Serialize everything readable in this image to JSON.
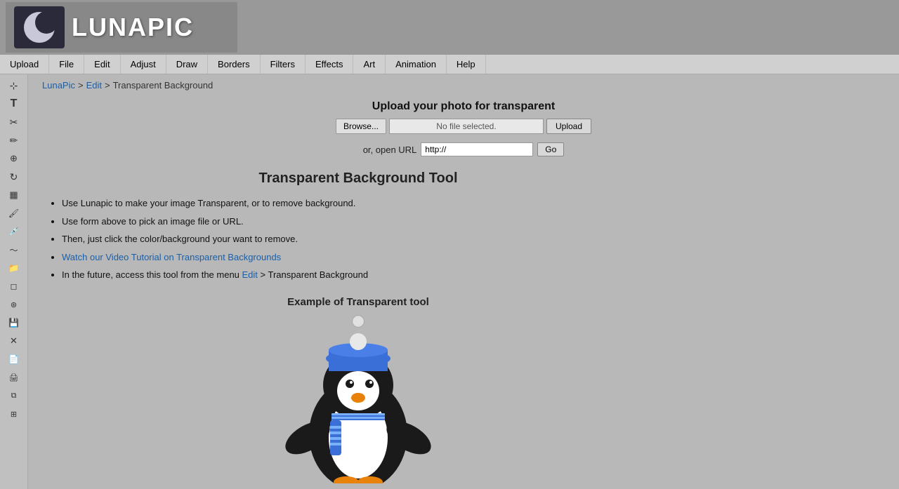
{
  "header": {
    "logo_text": "LUNAPIC"
  },
  "navbar": {
    "items": [
      {
        "id": "upload",
        "label": "Upload"
      },
      {
        "id": "file",
        "label": "File"
      },
      {
        "id": "edit",
        "label": "Edit"
      },
      {
        "id": "adjust",
        "label": "Adjust"
      },
      {
        "id": "draw",
        "label": "Draw"
      },
      {
        "id": "borders",
        "label": "Borders"
      },
      {
        "id": "filters",
        "label": "Filters"
      },
      {
        "id": "effects",
        "label": "Effects"
      },
      {
        "id": "art",
        "label": "Art"
      },
      {
        "id": "animation",
        "label": "Animation"
      },
      {
        "id": "help",
        "label": "Help"
      }
    ]
  },
  "breadcrumb": {
    "lunapic": "LunaPic",
    "edit": "Edit",
    "separator1": ">",
    "separator2": ">",
    "current": "Transparent Background"
  },
  "upload": {
    "title": "Upload your photo for transparent",
    "browse_label": "Browse...",
    "file_placeholder": "No file selected.",
    "upload_label": "Upload",
    "url_prefix": "or, open URL",
    "url_placeholder": "http://",
    "go_label": "Go"
  },
  "tool": {
    "title": "Transparent Background Tool",
    "bullets": [
      "Use Lunapic to make your image Transparent, or to remove background.",
      "Use form above to pick an image file or URL.",
      "Then, just click the color/background your want to remove.",
      "Watch our Video Tutorial on Transparent Backgrounds",
      "In the future, access this tool from the menu Edit > Transparent Background"
    ],
    "link_text": "Watch our Video Tutorial on Transparent Backgrounds",
    "menu_link_text": "Edit"
  },
  "example": {
    "title": "Example of Transparent tool"
  },
  "sidebar": {
    "icons": [
      {
        "id": "move",
        "symbol": "⊹",
        "name": "move-tool"
      },
      {
        "id": "text",
        "symbol": "T",
        "name": "text-tool"
      },
      {
        "id": "scissors",
        "symbol": "✂",
        "name": "cut-tool"
      },
      {
        "id": "pencil",
        "symbol": "✏",
        "name": "pencil-tool"
      },
      {
        "id": "zoom",
        "symbol": "🔍",
        "name": "zoom-tool"
      },
      {
        "id": "rotate",
        "symbol": "↻",
        "name": "rotate-tool"
      },
      {
        "id": "calendar",
        "symbol": "▦",
        "name": "calendar-tool"
      },
      {
        "id": "brush",
        "symbol": "🖌",
        "name": "brush-tool"
      },
      {
        "id": "eyedropper",
        "symbol": "⊘",
        "name": "eyedropper-tool"
      },
      {
        "id": "smudge",
        "symbol": "~",
        "name": "smudge-tool"
      },
      {
        "id": "folder",
        "symbol": "📁",
        "name": "folder-tool"
      },
      {
        "id": "eraser",
        "symbol": "◻",
        "name": "eraser-tool"
      },
      {
        "id": "stamp",
        "symbol": "⊛",
        "name": "stamp-tool"
      },
      {
        "id": "save",
        "symbol": "💾",
        "name": "save-tool"
      },
      {
        "id": "close",
        "symbol": "✕",
        "name": "close-tool"
      },
      {
        "id": "new",
        "symbol": "📄",
        "name": "new-tool"
      },
      {
        "id": "print",
        "symbol": "🖨",
        "name": "print-tool"
      },
      {
        "id": "copy",
        "symbol": "⧉",
        "name": "copy-tool"
      },
      {
        "id": "layers",
        "symbol": "⊞",
        "name": "layers-tool"
      }
    ]
  }
}
